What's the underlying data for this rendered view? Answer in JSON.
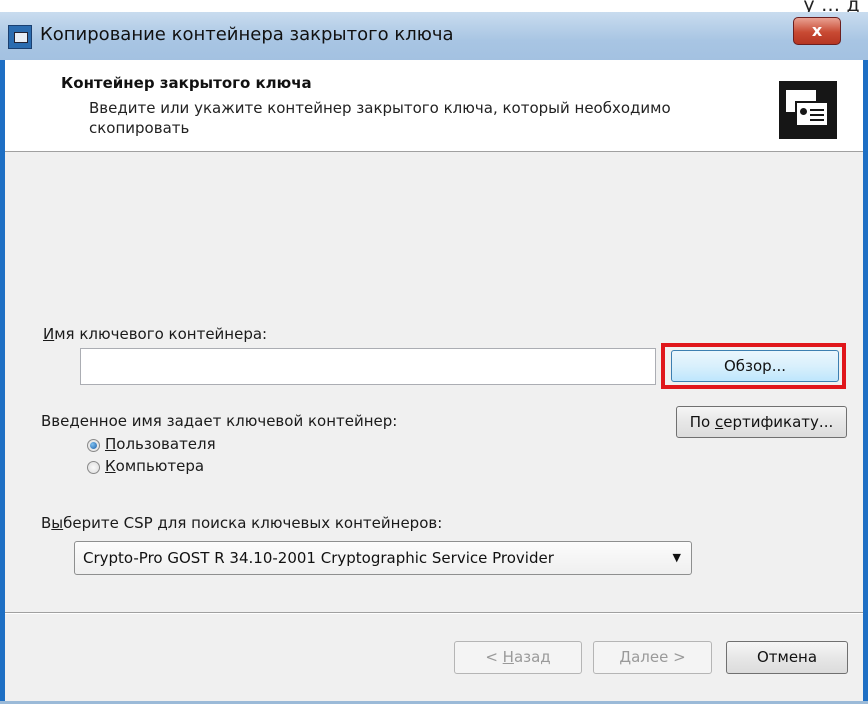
{
  "bg_caption": "у ... д",
  "window": {
    "title": "Копирование контейнера закрытого ключа",
    "close_label": "x"
  },
  "header": {
    "title": "Контейнер закрытого ключа",
    "description": "Введите или укажите контейнер закрытого ключа, который необходимо скопировать",
    "icon": "certificate-icon"
  },
  "container": {
    "label_prefix": "И",
    "label_rest": "мя ключевого контейнера:",
    "value": "",
    "browse_label": "Обзор...",
    "by_cert_prefix": "По ",
    "by_cert_ul": "с",
    "by_cert_rest": "ертификату..."
  },
  "scope": {
    "label": "Введенное имя задает ключевой контейнер:",
    "options": [
      {
        "ul": "П",
        "rest": "ользователя",
        "selected": true
      },
      {
        "ul": "К",
        "rest": "омпьютера",
        "selected": false
      }
    ]
  },
  "csp": {
    "label_prefix": "В",
    "label_ul": "ы",
    "label_rest": "берите CSP для поиска ключевых контейнеров:",
    "selected": "Crypto-Pro GOST R 34.10-2001 Cryptographic Service Provider"
  },
  "footer": {
    "back_prefix": "< ",
    "back_ul": "Н",
    "back_rest": "азад",
    "next_ul": "Д",
    "next_rest": "алее >",
    "cancel_label": "Отмена"
  },
  "colors": {
    "highlight_frame": "#e0161b",
    "window_border": "#1e6fc4"
  }
}
